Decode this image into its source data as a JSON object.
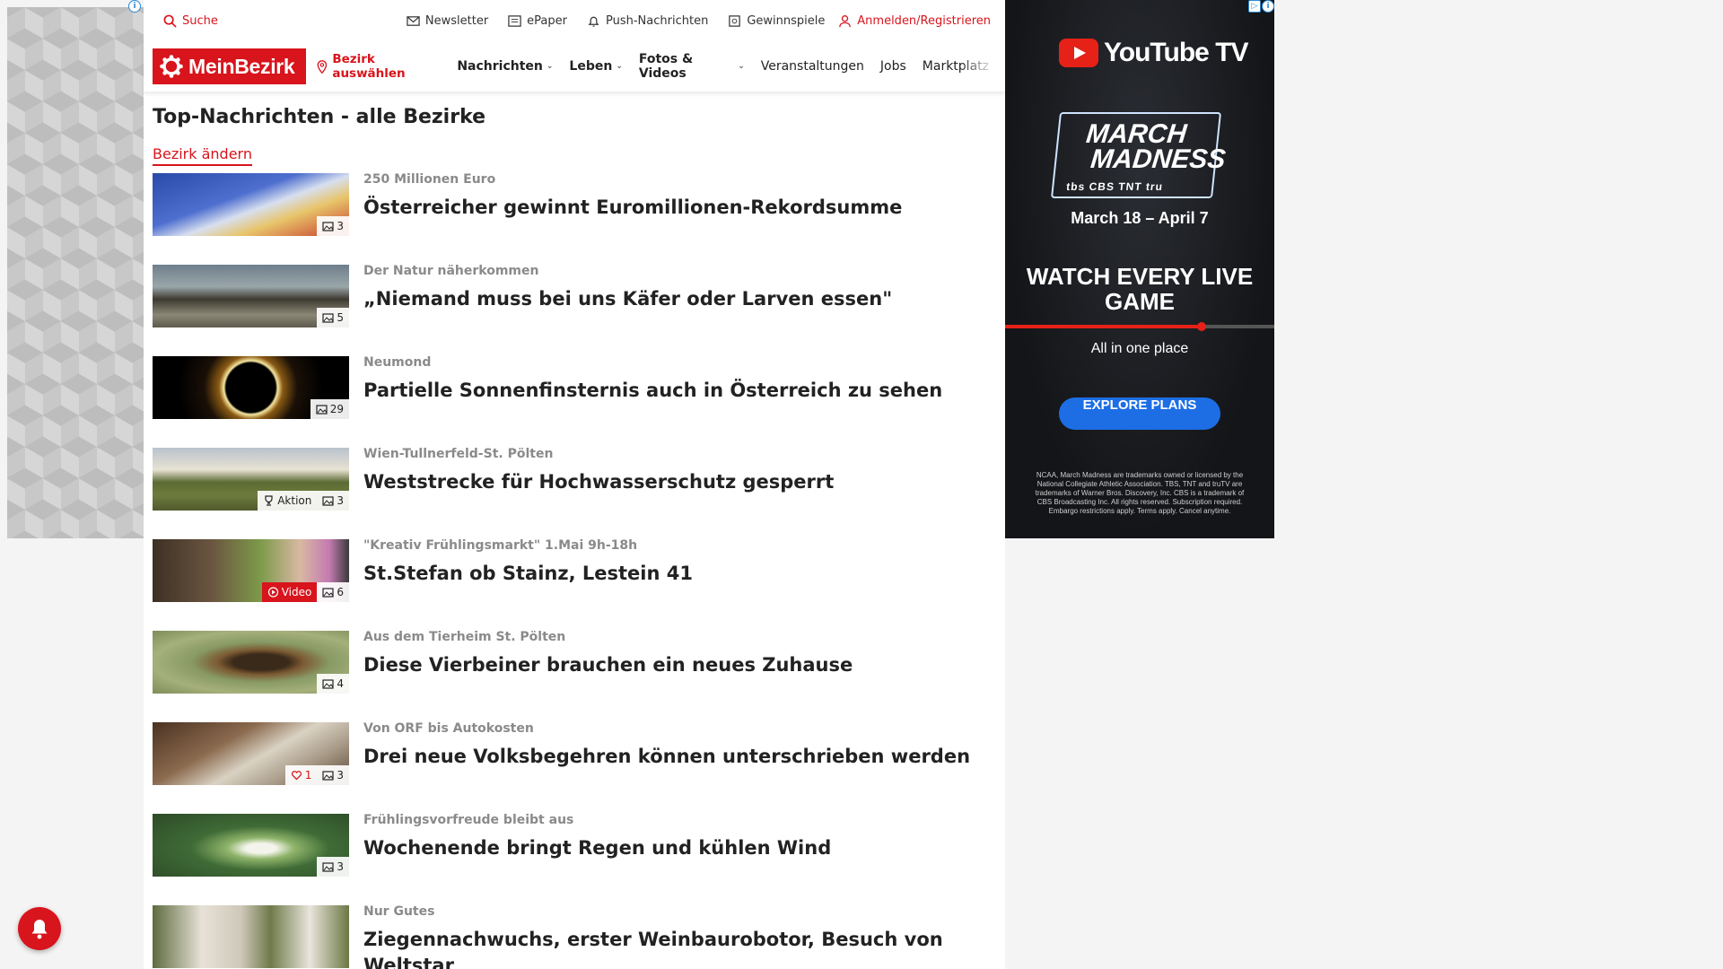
{
  "topbar": {
    "search_label": "Suche",
    "newsletter_label": "Newsletter",
    "epaper_label": "ePaper",
    "push_label": "Push-Nachrichten",
    "gewinnspiele_label": "Gewinnspiele",
    "login_label": "Anmelden/Registrieren"
  },
  "nav": {
    "logo_text": "MeinBezirk",
    "bezirk_label": "Bezirk auswählen",
    "items": [
      {
        "label": "Nachrichten"
      },
      {
        "label": "Leben"
      },
      {
        "label": "Fotos & Videos"
      },
      {
        "label": "Veranstaltungen"
      },
      {
        "label": "Jobs"
      },
      {
        "label": "Marktplatz"
      }
    ]
  },
  "page": {
    "title": "Top-Nachrichten - alle Bezirke",
    "change_link": "Bezirk ändern"
  },
  "articles": [
    {
      "kicker": "250 Millionen Euro",
      "headline": "Österreicher gewinnt Euromillionen-Rekordsumme",
      "images": "3"
    },
    {
      "kicker": "Der Natur näherkommen",
      "headline": "„Niemand muss bei uns Käfer oder Larven essen\"",
      "images": "5"
    },
    {
      "kicker": "Neumond",
      "headline": "Partielle Sonnenfinsternis auch in Österreich zu sehen",
      "images": "29"
    },
    {
      "kicker": "Wien-Tullnerfeld-St. Pölten",
      "headline": "Weststrecke für Hochwasserschutz gesperrt",
      "images": "3",
      "extra": "Aktion"
    },
    {
      "kicker": "\"Kreativ Frühlingsmarkt\" 1.Mai 9h-18h",
      "headline": "St.Stefan ob Stainz, Lestein 41",
      "images": "6",
      "extra": "Video"
    },
    {
      "kicker": "Aus dem Tierheim St. Pölten",
      "headline": "Diese Vierbeiner brauchen ein neues Zuhause",
      "images": "4"
    },
    {
      "kicker": "Von ORF bis Autokosten",
      "headline": "Drei neue Volksbegehren können unterschrieben werden",
      "images": "3",
      "likes": "1"
    },
    {
      "kicker": "Frühlingsvorfreude bleibt aus",
      "headline": "Wochenende bringt Regen und kühlen Wind",
      "images": "3"
    },
    {
      "kicker": "Nur Gutes",
      "headline": "Ziegennachwuchs, erster Weinbaurobotor, Besuch von Weltstar",
      "images": ""
    }
  ],
  "ad": {
    "brand": "YouTube TV",
    "event_line1": "MARCH",
    "event_line2": "MADNESS",
    "networks": "tbs  CBS  TNT  tru",
    "dates": "March 18 – April 7",
    "headline": "WATCH EVERY LIVE GAME",
    "progress": 0.73,
    "subline": "All in one place",
    "cta": "EXPLORE PLANS",
    "fine_print": "NCAA, March Madness are trademarks owned or licensed by the National Collegiate Athletic Association. TBS, TNT and truTV are trademarks of Warner Bros. Discovery, Inc. CBS is a trademark of CBS Broadcasting Inc. All rights reserved. Subscription required. Embargo restrictions apply. Terms apply. Cancel anytime."
  },
  "colors": {
    "brand_red": "#d8141c",
    "ad_blue": "#1d6ee5"
  }
}
